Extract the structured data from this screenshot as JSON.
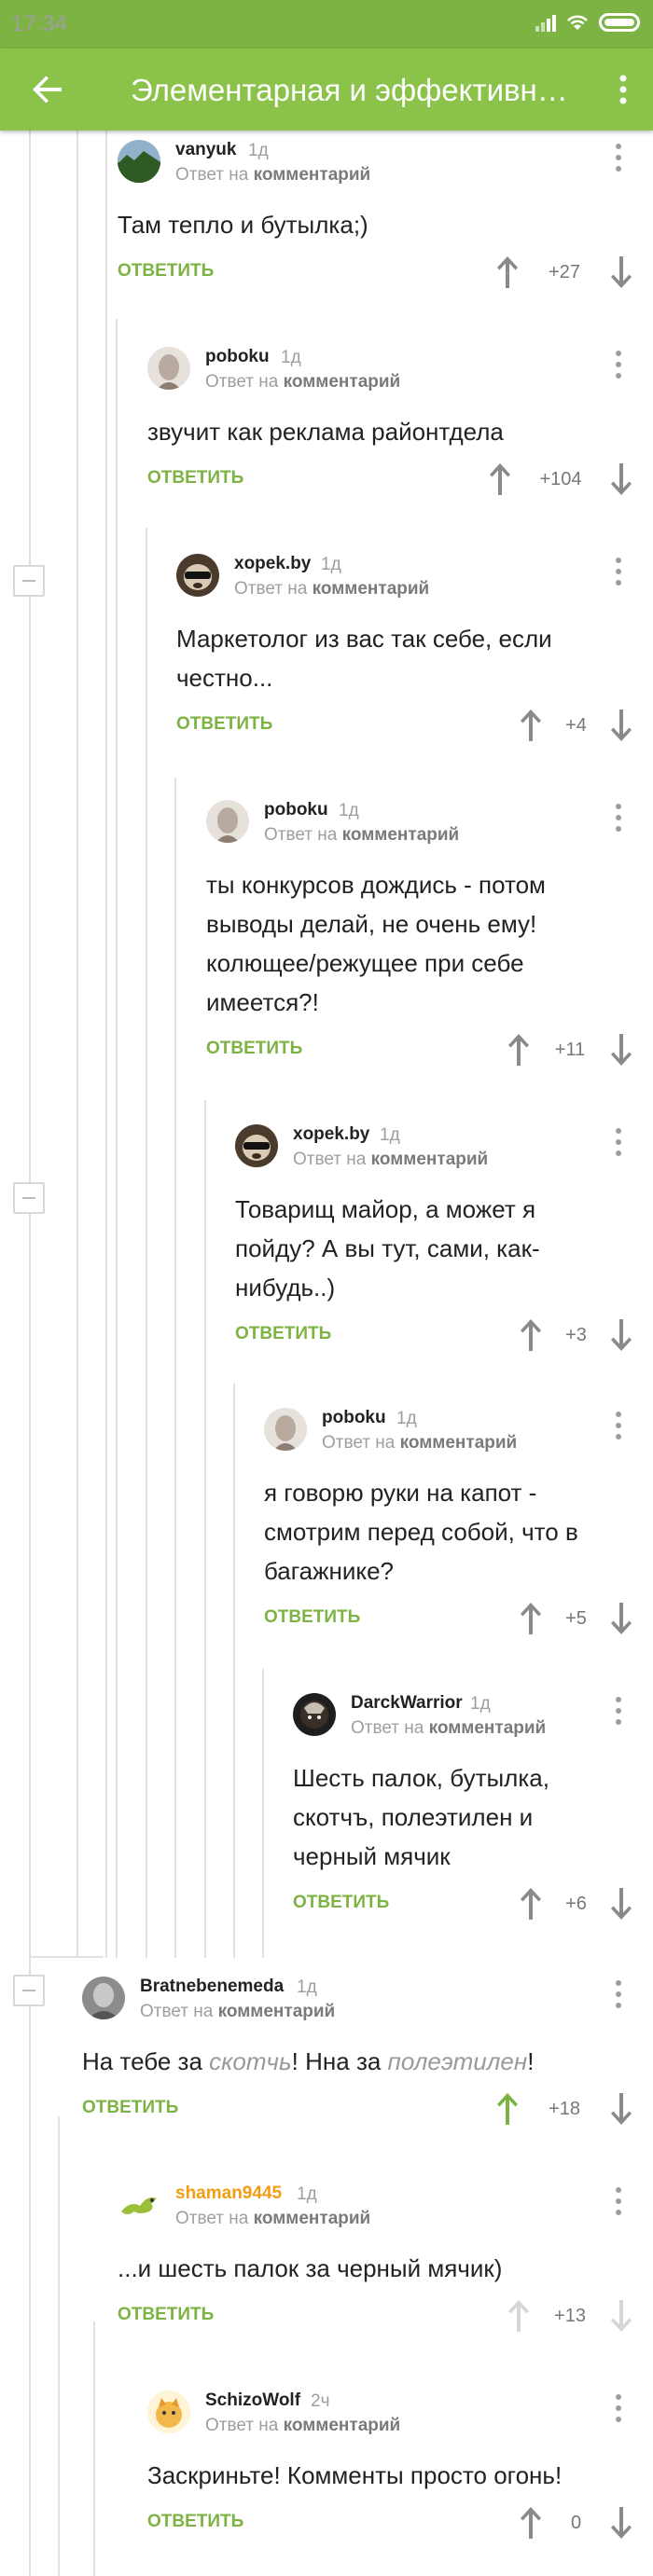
{
  "status_bar": {
    "time": "17:34"
  },
  "app_bar": {
    "title": "Элементарная и эффективная ...",
    "back_icon": "arrow-left-icon",
    "menu_icon": "more-vert-icon"
  },
  "labels": {
    "reply_prefix": "Ответ на",
    "reply_target": "комментарий",
    "answer": "ОТВЕТИТЬ"
  },
  "colors": {
    "accent": "#8bc34a",
    "answer": "#7cb342",
    "upvoted": "#7cb342",
    "author_highlight": "#f39c12"
  },
  "comments": [
    {
      "author": "vanyuk",
      "time": "1д",
      "text": "Там тепло и бутылка;)",
      "score": "+27"
    },
    {
      "author": "poboku",
      "time": "1д",
      "text": "звучит как реклама районтдела",
      "score": "+104"
    },
    {
      "author": "xopek.by",
      "time": "1д",
      "text": "Маркетолог из вас так себе, если честно...",
      "score": "+4"
    },
    {
      "author": "poboku",
      "time": "1д",
      "text": "ты конкурсов дождись - потом выводы делай, не очень ему! колющее/режущее при себе имеется?!",
      "score": "+11"
    },
    {
      "author": "xopek.by",
      "time": "1д",
      "text": "Товарищ майор, а может я пойду? А вы тут, сами, как-нибудь..)",
      "score": "+3"
    },
    {
      "author": "poboku",
      "time": "1д",
      "text": "я говорю руки на капот - смотрим перед собой, что в багажнике?",
      "score": "+5"
    },
    {
      "author": "DarckWarrior",
      "time": "1д",
      "text": "Шесть палок, бутылка, скотчъ, полеэтилен и черный мячик",
      "score": "+6"
    },
    {
      "author": "Bratnebenemeda",
      "time": "1д",
      "text_parts": [
        "На тебе за ",
        "скотчь",
        "! Нна за ",
        "полеэтилен",
        "!"
      ],
      "score": "+18",
      "upvoted": true
    },
    {
      "author": "shaman9445",
      "time": "1д",
      "text": "...и шесть палок за черный мячик)",
      "score": "+13",
      "votes_disabled": true
    },
    {
      "author": "SchizoWolf",
      "time": "2ч",
      "text": "Заскриньте! Комменты просто огонь!",
      "score": "0"
    }
  ]
}
